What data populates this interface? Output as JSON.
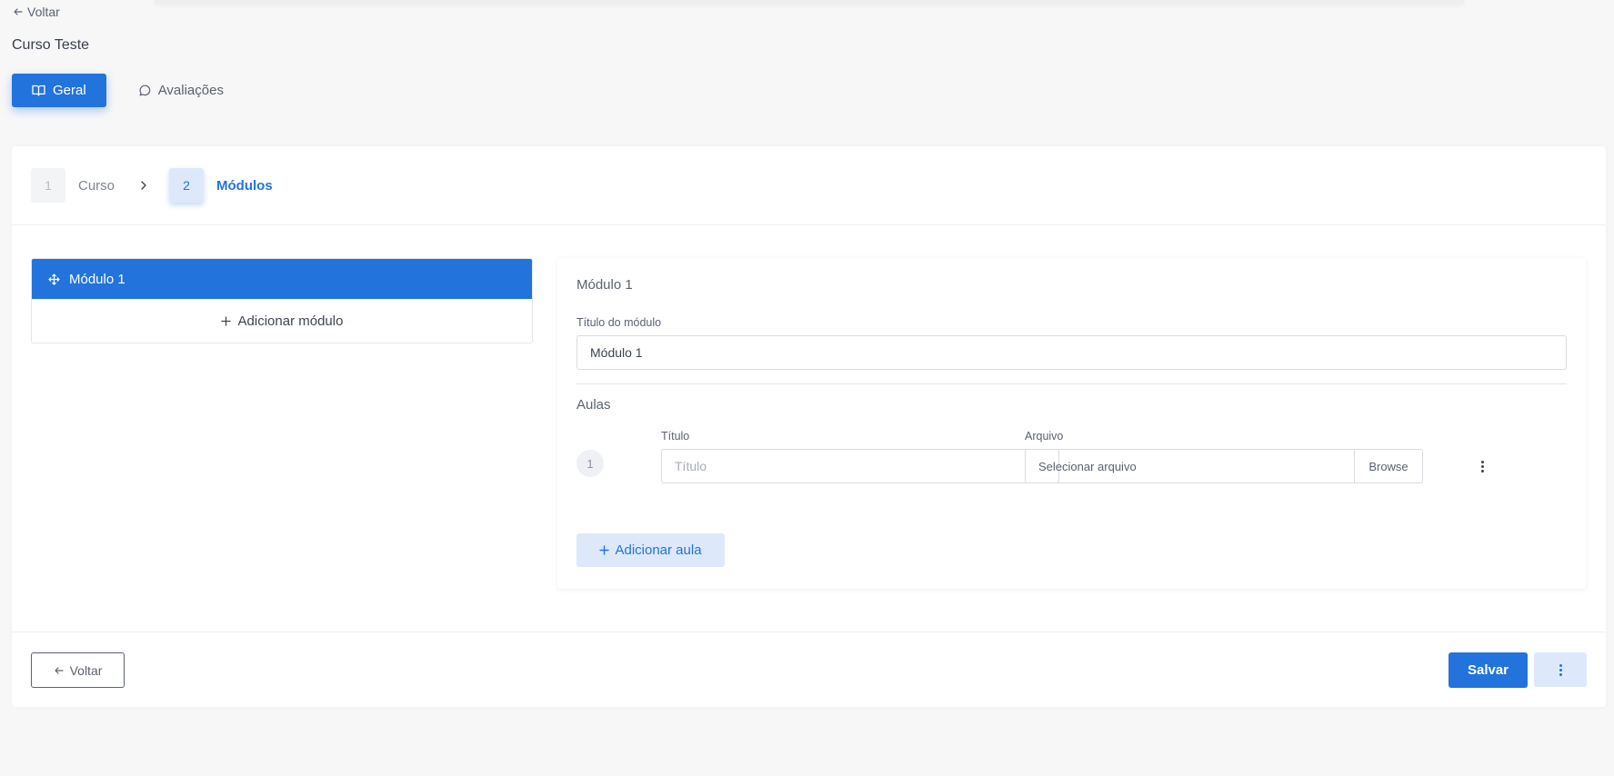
{
  "header": {
    "back_label": "Voltar",
    "page_title": "Curso Teste"
  },
  "tabs": [
    {
      "label": "Geral",
      "icon": "book-open-icon",
      "active": true
    },
    {
      "label": "Avaliações",
      "icon": "message-circle-icon",
      "active": false
    }
  ],
  "stepper": {
    "steps": [
      {
        "number": "1",
        "label": "Curso",
        "active": false
      },
      {
        "number": "2",
        "label": "Módulos",
        "active": true
      }
    ]
  },
  "modules": {
    "items": [
      {
        "label": "Módulo 1",
        "selected": true
      }
    ],
    "add_label": "Adicionar módulo"
  },
  "module_form": {
    "heading": "Módulo 1",
    "title_label": "Título do módulo",
    "title_value": "Módulo 1",
    "lessons_title": "Aulas",
    "lessons": [
      {
        "number": "1",
        "title_label": "Título",
        "title_placeholder": "Título",
        "file_label": "Arquivo",
        "file_placeholder": "Selecionar arquivo",
        "browse_label": "Browse"
      }
    ],
    "add_lesson_label": "Adicionar aula"
  },
  "footer": {
    "back_label": "Voltar",
    "save_label": "Salvar"
  },
  "colors": {
    "primary": "#2274dc",
    "primary_light": "#dde9fb",
    "background": "#f7f7f8"
  }
}
